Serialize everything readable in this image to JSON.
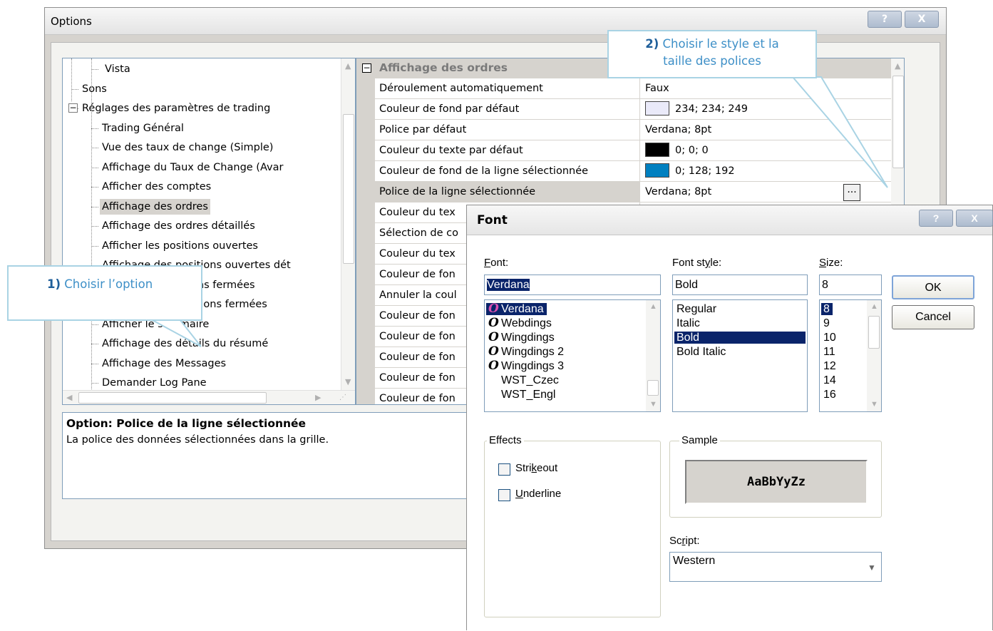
{
  "options": {
    "title": "Options",
    "help_btn": "?",
    "close_btn": "X",
    "tree": {
      "items": [
        {
          "label": "Vista",
          "indent": 3
        },
        {
          "label": "Sons",
          "indent": 1
        },
        {
          "label": "Réglages des paramètres de trading",
          "indent": 1,
          "expander": "−"
        },
        {
          "label": "Trading Général",
          "indent": 2
        },
        {
          "label": "Vue des taux de change (Simple)",
          "indent": 2
        },
        {
          "label": "Affichage du Taux de Change (Avar",
          "indent": 2
        },
        {
          "label": "Afficher des comptes",
          "indent": 2
        },
        {
          "label": "Affichage des ordres",
          "indent": 2,
          "selected": true
        },
        {
          "label": "Affichage des ordres détaillés",
          "indent": 2
        },
        {
          "label": "Afficher les positions ouvertes",
          "indent": 2
        },
        {
          "label": "Affichage des positions ouvertes dét",
          "indent": 2
        },
        {
          "label": "Afficher les positions fermées",
          "indent": 2
        },
        {
          "label": "Affichage des positions fermées",
          "indent": 2
        },
        {
          "label": "Afficher le sommaire",
          "indent": 2
        },
        {
          "label": "Affichage des détails du résumé",
          "indent": 2
        },
        {
          "label": "Affichage des Messages",
          "indent": 2
        },
        {
          "label": "Demander Log Pane",
          "indent": 2
        }
      ]
    },
    "grid": {
      "section": "Affichage des ordres",
      "collapse": "−",
      "rows": [
        {
          "name": "Déroulement automatiquement",
          "value": "Faux"
        },
        {
          "name": "Couleur de fond par défaut",
          "value": "234; 234; 249",
          "swatch": "#eaeaf9"
        },
        {
          "name": "Police par défaut",
          "value": "Verdana; 8pt"
        },
        {
          "name": "Couleur du texte par défaut",
          "value": "0; 0; 0",
          "swatch": "#000000"
        },
        {
          "name": "Couleur de fond de la ligne sélectionnée",
          "value": "0; 128; 192",
          "swatch": "#0080c0"
        },
        {
          "name": "Police de la ligne sélectionnée",
          "value": "Verdana; 8pt",
          "selected": true
        },
        {
          "name": "Couleur du tex",
          "value": ""
        },
        {
          "name": "Sélection de co",
          "value": ""
        },
        {
          "name": "Couleur du tex",
          "value": ""
        },
        {
          "name": "Couleur de fon",
          "value": ""
        },
        {
          "name": "Annuler la coul",
          "value": ""
        },
        {
          "name": "Couleur de fon",
          "value": ""
        },
        {
          "name": "Couleur de fon",
          "value": ""
        },
        {
          "name": "Couleur de fon",
          "value": ""
        },
        {
          "name": "Couleur de fon",
          "value": ""
        },
        {
          "name": "Couleur de fon",
          "value": ""
        }
      ],
      "ellipsis": "..."
    },
    "description": {
      "title": "Option: Police de la ligne sélectionnée",
      "text": "La police des données sélectionnées dans la grille."
    }
  },
  "font_dialog": {
    "title": "Font",
    "help_btn": "?",
    "close_btn": "X",
    "font_label_first": "F",
    "font_label_rest": "ont:",
    "font_value": "Verdana",
    "fonts": [
      {
        "name": "Verdana",
        "glyph": "O",
        "glyph_color": "#d94fb0",
        "selected": true
      },
      {
        "name": "Webdings",
        "glyph": "O",
        "glyph_color": "#000000"
      },
      {
        "name": "Wingdings",
        "glyph": "O",
        "glyph_color": "#000000"
      },
      {
        "name": "Wingdings 2",
        "glyph": "O",
        "glyph_color": "#000000"
      },
      {
        "name": "Wingdings 3",
        "glyph": "O",
        "glyph_color": "#000000"
      },
      {
        "name": "WST_Czec",
        "glyph": "",
        "glyph_color": "#000000"
      },
      {
        "name": "WST_Engl",
        "glyph": "",
        "glyph_color": "#000000"
      }
    ],
    "style_label_pre": "Font st",
    "style_label_u": "y",
    "style_label_post": "le:",
    "style_value": "Bold",
    "styles": [
      {
        "name": "Regular"
      },
      {
        "name": "Italic"
      },
      {
        "name": "Bold",
        "selected": true
      },
      {
        "name": "Bold Italic"
      }
    ],
    "size_label_u": "S",
    "size_label_rest": "ize:",
    "size_value": "8",
    "sizes": [
      {
        "name": "8",
        "selected": true
      },
      {
        "name": "9"
      },
      {
        "name": "10"
      },
      {
        "name": "11"
      },
      {
        "name": "12"
      },
      {
        "name": "14"
      },
      {
        "name": "16"
      }
    ],
    "ok": "OK",
    "cancel": "Cancel",
    "effects_label": "Effects",
    "strikeout_pre": "Stri",
    "strikeout_u": "k",
    "strikeout_post": "eout",
    "underline_u": "U",
    "underline_rest": "nderline",
    "sample_label": "Sample",
    "sample_text": "AaBbYyZz",
    "script_label_pre": "Sc",
    "script_label_u": "r",
    "script_label_post": "ipt:",
    "script_value": "Western"
  },
  "callouts": {
    "step1_num": "1)",
    "step1_text": " Choisir l’option",
    "step2_num": "2)",
    "step2_text_a": " Choisir le style et la",
    "step2_text_b": "taille des polices"
  }
}
